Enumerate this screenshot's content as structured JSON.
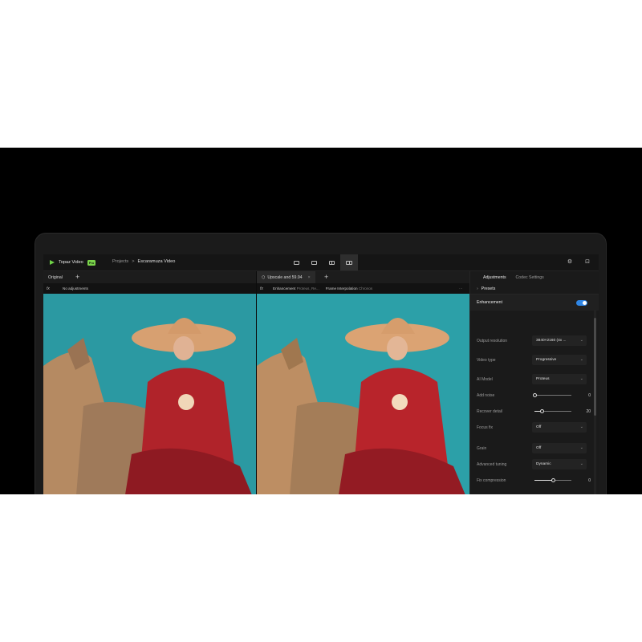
{
  "app": {
    "name": "Topaz Video",
    "badge": "Pro",
    "breadcrumb": {
      "projects": "Projects",
      "separator": ">",
      "current": "Escaramuza Video"
    }
  },
  "left_pane": {
    "tab_label": "Original",
    "add_label": "+",
    "fx_label": "fx",
    "adjustments_text": "No adjustments"
  },
  "right_pane": {
    "tab_label": "Upscale and 59.94",
    "close_label": "×",
    "add_label": "+",
    "fx_label": "fx",
    "enhancement_label": "Enhancement",
    "enhancement_value": "Proteus, Re...",
    "frame_interp_label": "Frame Interpolation",
    "frame_interp_value": "Chronos",
    "more_label": "···"
  },
  "panel": {
    "tabs": [
      "Adjustments",
      "Codec Settings"
    ],
    "active_tab": "Adjustments",
    "presets_label": "Presets",
    "enhancement": {
      "label": "Enhancement",
      "enabled": true
    },
    "settings": [
      {
        "label": "Output resolution",
        "type": "select",
        "value": "3840×2160 (4x ..."
      },
      {
        "label": "Video type",
        "type": "select",
        "value": "Progressive"
      },
      {
        "label": "AI Model",
        "type": "select",
        "value": "Proteus"
      },
      {
        "label": "Add noise",
        "type": "slider",
        "value": "0",
        "level": 0
      },
      {
        "label": "Recover detail",
        "type": "slider",
        "value": "20",
        "level": 0.2
      },
      {
        "label": "Focus fix",
        "type": "select",
        "value": "Off"
      },
      {
        "label": "Grain",
        "type": "select",
        "value": "Off"
      },
      {
        "label": "Advanced tuning",
        "type": "select",
        "value": "Dynamic"
      },
      {
        "label": "Fix compression",
        "type": "slider",
        "value": "0",
        "level": 0.5
      },
      {
        "label": "Improve detail",
        "type": "slider",
        "value": "8",
        "level": 0.55
      }
    ]
  },
  "colors": {
    "accent": "#2f86e6",
    "brand": "#6fd347",
    "sky": "#2b99a2",
    "dress": "#b0232a"
  }
}
